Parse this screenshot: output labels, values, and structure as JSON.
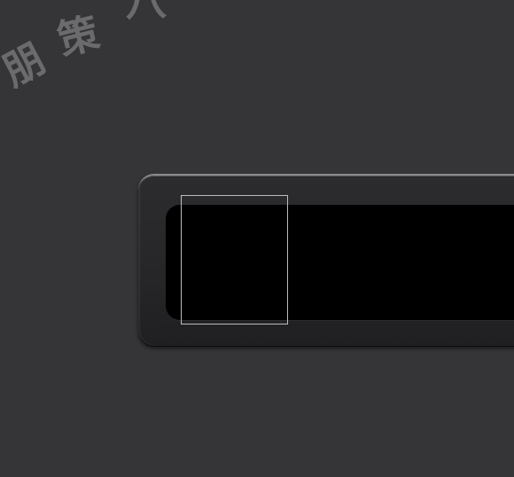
{
  "watermark": {
    "chars": [
      "朋",
      "策",
      "八"
    ],
    "color": "#6b6b6d"
  },
  "colors": {
    "background": "#353537",
    "bezel": "#262628",
    "bezel_highlight": "#8a8a8c",
    "screen": "#000000",
    "selection_border": "#bdbdbd"
  }
}
